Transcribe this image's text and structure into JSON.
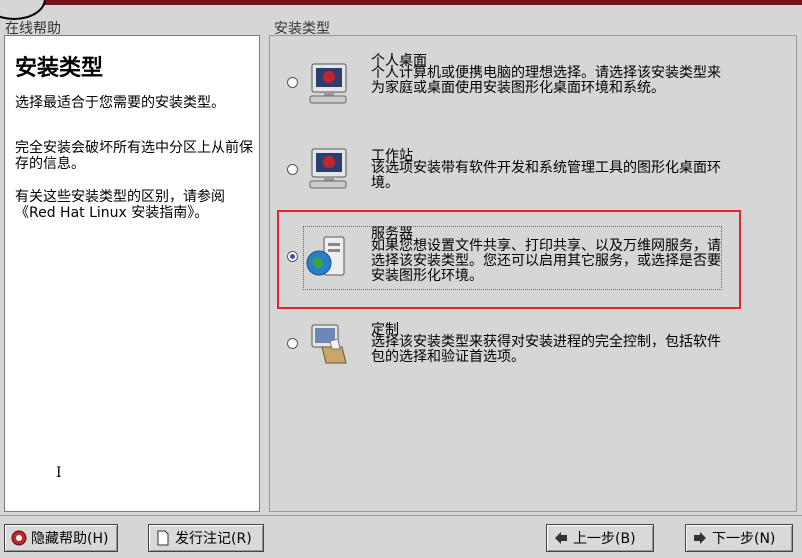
{
  "help": {
    "section_title": "在线帮助",
    "heading": "安装类型",
    "paragraphs": [
      "选择最适合于您需要的安装类型。",
      "完全安装会破坏所有选中分区上从前保存的信息。",
      "有关这些安装类型的区别，请参阅《Red Hat Linux 安装指南》。"
    ]
  },
  "install_types": {
    "section_title": "安装类型",
    "options": [
      {
        "label": "个人桌面",
        "description": "个人计算机或便携电脑的理想选择。请选择该安装类型来为家庭或桌面使用安装图形化桌面环境和系统。",
        "selected": false,
        "icon": "desktop-monitor-icon"
      },
      {
        "label": "工作站",
        "description": "该选项安装带有软件开发和系统管理工具的图形化桌面环境。",
        "selected": false,
        "icon": "workstation-monitor-icon"
      },
      {
        "label": "服务器",
        "description": "如果您想设置文件共享、打印共享、以及万维网服务，请选择该安装类型。您还可以启用其它服务，或选择是否要安装图形化环境。",
        "selected": true,
        "icon": "server-globe-icon"
      },
      {
        "label": "定制",
        "description": "选择该安装类型来获得对安装进程的完全控制，包括软件包的选择和验证首选项。",
        "selected": false,
        "icon": "custom-package-icon"
      }
    ]
  },
  "buttons": {
    "hide_help": "隐藏帮助(H)",
    "release_notes": "发行注记(R)",
    "back": "上一步(B)",
    "next": "下一步(N)"
  },
  "colors": {
    "highlight": "#e0262b",
    "selected_radio": "#3a4fb0",
    "title_bar": "#6e1a1a"
  }
}
